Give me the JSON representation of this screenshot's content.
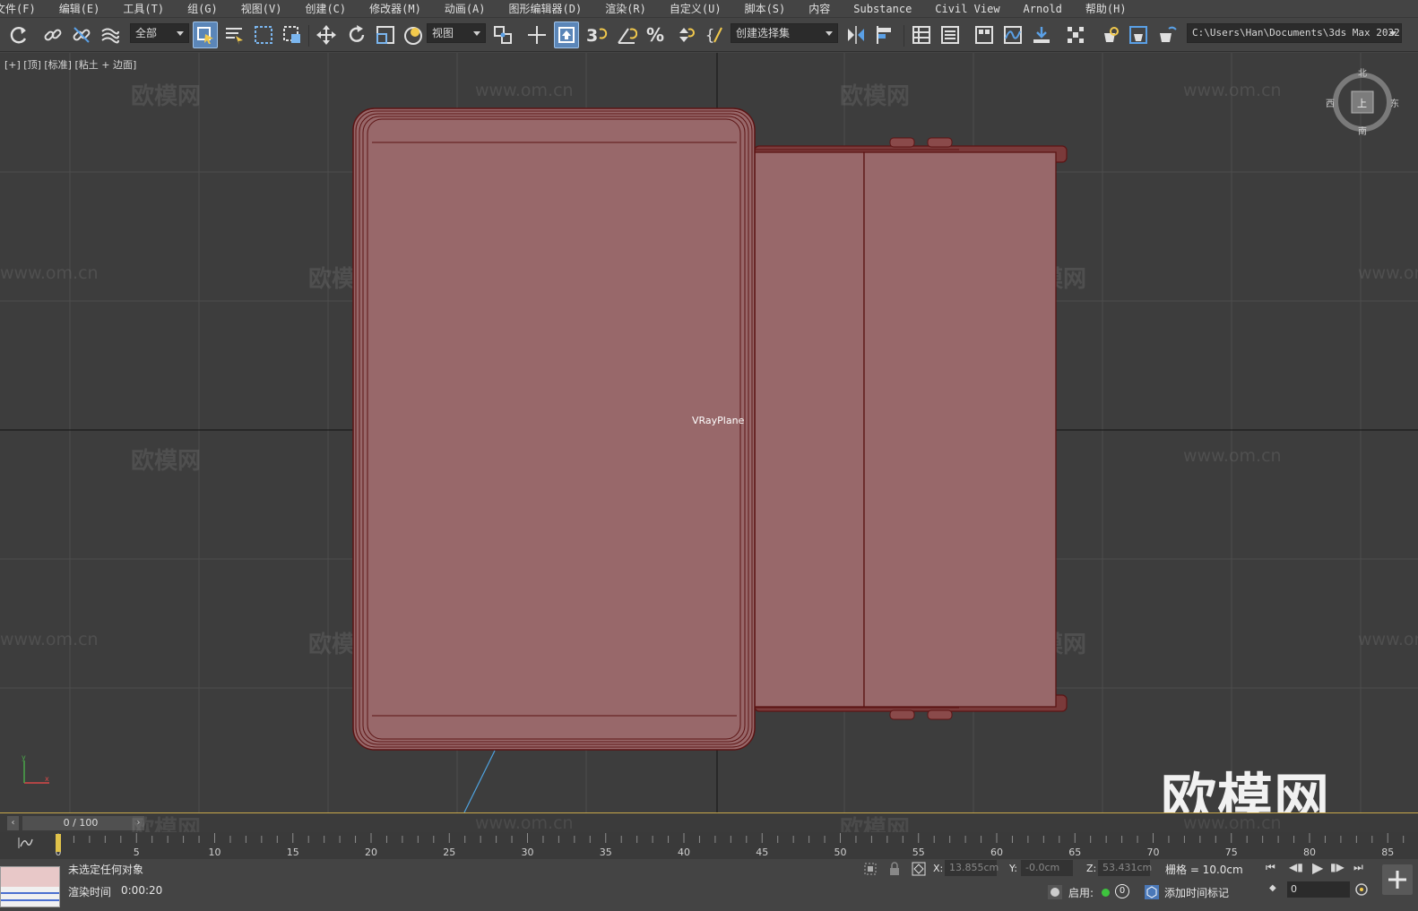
{
  "menu": {
    "items": [
      "文件(F)",
      "编辑(E)",
      "工具(T)",
      "组(G)",
      "视图(V)",
      "创建(C)",
      "修改器(M)",
      "动画(A)",
      "图形编辑器(D)",
      "渲染(R)",
      "自定义(U)",
      "脚本(S)",
      "内容",
      "Substance",
      "Civil View",
      "Arnold",
      "帮助(H)"
    ]
  },
  "toolbar": {
    "selection_filter": "全部",
    "reference_coord": "视图",
    "named_selection": "创建选择集",
    "project_path": "C:\\Users\\Han\\Documents\\3ds Max 2022"
  },
  "viewport": {
    "label": "[+] [顶] [标准] [粘土 + 边面]",
    "object_label": "VRayPlane",
    "watermark_text": "欧模网",
    "watermark_url": "www.om.cn",
    "logo_text": "欧模网",
    "viewcube": {
      "north": "北",
      "south": "南",
      "east": "东",
      "west": "西",
      "face": "上"
    },
    "colors": {
      "object_fill": "#98686a",
      "object_edge": "#5c1414",
      "background": "#3d3d3d",
      "grid": "#4d4d4d"
    }
  },
  "timeline": {
    "frame_counter": "0 / 100",
    "ticks": [
      "0",
      "5",
      "10",
      "15",
      "20",
      "25",
      "30",
      "35",
      "40",
      "45",
      "50",
      "55",
      "60",
      "65",
      "70",
      "75",
      "80",
      "85"
    ]
  },
  "status": {
    "selection": "未选定任何对象",
    "render_time_label": "渲染时间",
    "render_time": "0:00:20",
    "x_label": "X:",
    "x_value": "13.855cm",
    "y_label": "Y:",
    "y_value": "-0.0cm",
    "z_label": "Z:",
    "z_value": "53.431cm",
    "grid_label": "栅格 = 10.0cm",
    "enable_label": "启用:",
    "enable_count": "0",
    "add_time_tag": "添加时间标记",
    "current_frame": "0"
  }
}
